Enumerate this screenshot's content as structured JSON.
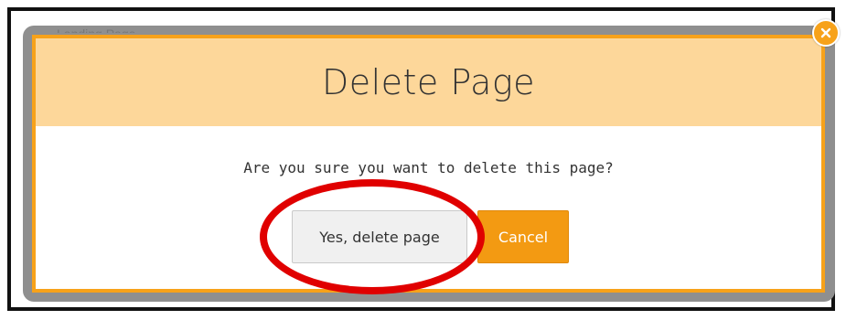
{
  "background_page": {
    "title": "Landing Page"
  },
  "dialog": {
    "title": "Delete Page",
    "message": "Are you sure you want to delete this page?",
    "confirm_label": "Yes, delete page",
    "cancel_label": "Cancel",
    "close_icon": "close-icon"
  },
  "colors": {
    "accent": "#f7a21a",
    "header_bg": "#fdd79a",
    "cancel_bg": "#f39a12",
    "annotation": "#e00000"
  }
}
